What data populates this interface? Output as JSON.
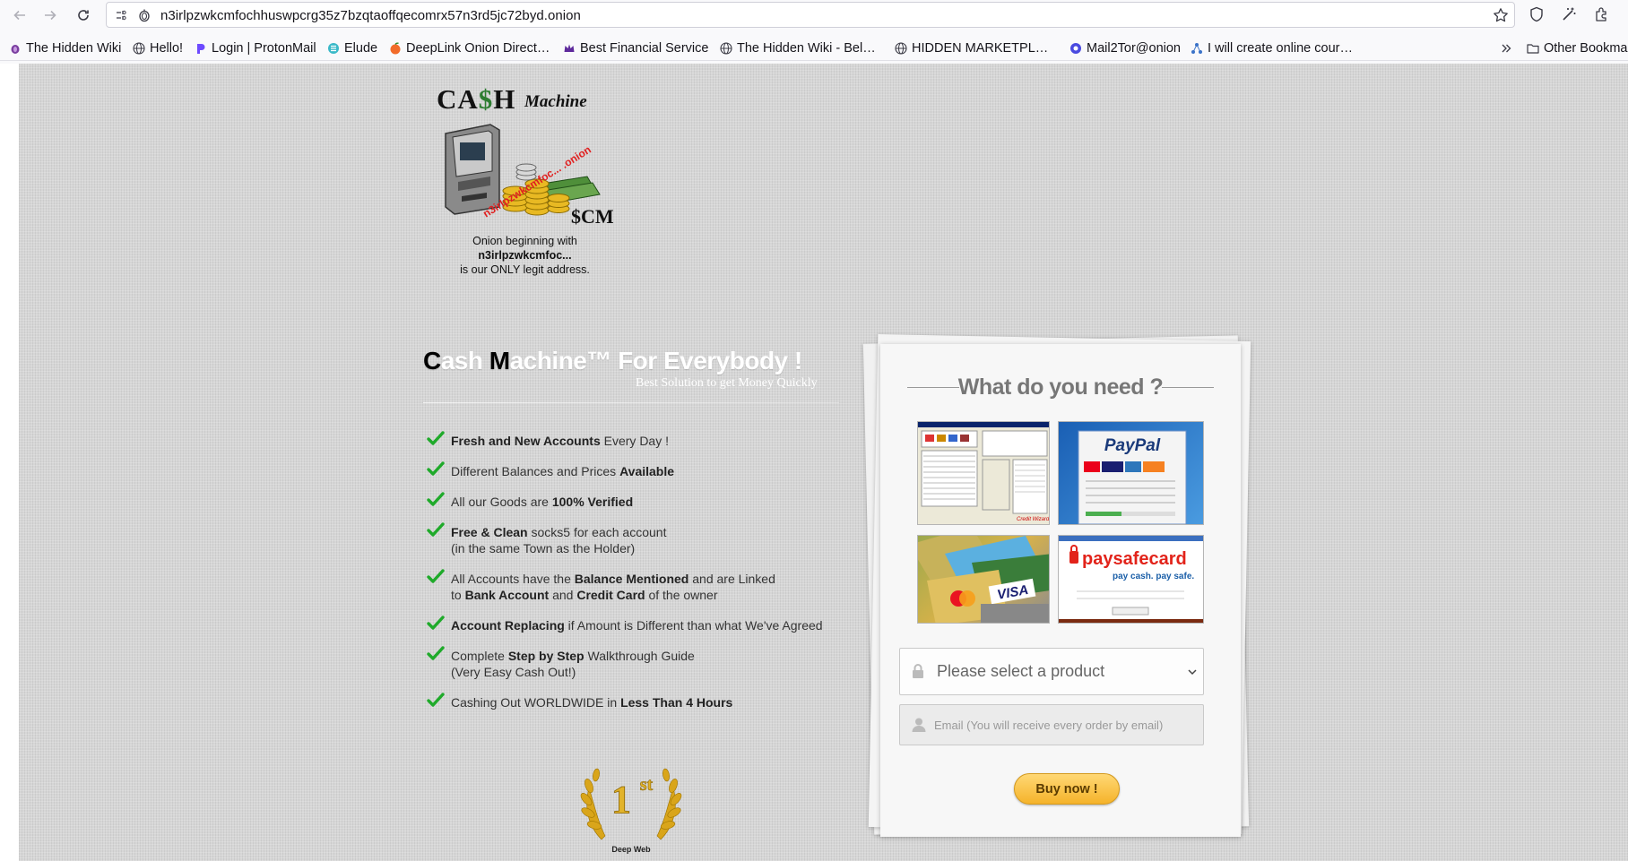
{
  "browser": {
    "url": "n3irlpzwkcmfochhuswpcrg35z7bzqtaoffqecomrx57n3rd5jc72byd.onion",
    "bookmarks": [
      {
        "label": "The Hidden Wiki",
        "icon": "onion-icon"
      },
      {
        "label": "Hello!",
        "icon": "globe-icon"
      },
      {
        "label": "Login | ProtonMail",
        "icon": "proton-icon"
      },
      {
        "label": "Elude",
        "icon": "elude-icon"
      },
      {
        "label": "DeepLink Onion Direct…",
        "icon": "peach-icon"
      },
      {
        "label": "Best Financial Service",
        "icon": "crown-icon"
      },
      {
        "label": "The Hidden Wiki - Bel…",
        "icon": "globe-icon"
      },
      {
        "label": "HIDDEN MARKETPL…",
        "icon": "globe-icon"
      },
      {
        "label": "Mail2Tor@onion",
        "icon": "mail2tor-icon"
      },
      {
        "label": "I will create online cour…",
        "icon": "network-icon"
      }
    ],
    "other_bookmarks": "Other Bookma"
  },
  "logo": {
    "title": "CA$H",
    "title_script": "Machine",
    "stamp": "n3irlpzwkcmfoc... .onion",
    "caption_line1": "Onion beginning with",
    "caption_line2": "n3irlpzwkcmfoc...",
    "caption_line3": "is our ONLY legit address."
  },
  "hero": {
    "headline_c": "C",
    "headline_ash": "ash ",
    "headline_m": "M",
    "headline_rest": "achine™ For Everybody !",
    "subhead": "Best Solution to get Money Quickly"
  },
  "features": [
    {
      "parts": [
        {
          "b": "Fresh and New Accounts"
        },
        {
          "t": " Every Day !"
        }
      ]
    },
    {
      "parts": [
        {
          "t": "Different Balances and Prices "
        },
        {
          "b": "Available"
        }
      ]
    },
    {
      "parts": [
        {
          "t": "All our Goods are "
        },
        {
          "b": "100% Verified"
        }
      ]
    },
    {
      "parts": [
        {
          "b": "Free & Clean"
        },
        {
          "t": " socks5 for each account"
        }
      ],
      "line2": "(in the same Town as the Holder)"
    },
    {
      "parts": [
        {
          "t": "All Accounts have the "
        },
        {
          "b": "Balance Mentioned"
        },
        {
          "t": " and are Linked"
        }
      ],
      "line2_parts": [
        {
          "t": "to "
        },
        {
          "b": "Bank Account"
        },
        {
          "t": " and "
        },
        {
          "b": "Credit Card"
        },
        {
          "t": " of the owner"
        }
      ]
    },
    {
      "parts": [
        {
          "b": "Account Replacing"
        },
        {
          "t": " if Amount is Different than what We've Agreed"
        }
      ]
    },
    {
      "parts": [
        {
          "t": "Complete "
        },
        {
          "b": "Step by Step"
        },
        {
          "t": " Walkthrough Guide"
        }
      ],
      "line2": "(Very Easy Cash Out!)"
    },
    {
      "parts": [
        {
          "t": "Cashing Out WORLDWIDE in "
        },
        {
          "b": "Less Than 4 Hours"
        }
      ]
    }
  ],
  "award": {
    "rank": "1st",
    "label": "Deep Web"
  },
  "order_panel": {
    "title": "What do you need ?",
    "products": [
      {
        "name": "credit-wizard-thumb",
        "label": "Credit Wizard"
      },
      {
        "name": "paypal-thumb",
        "label": "PayPal"
      },
      {
        "name": "credit-cards-thumb",
        "label": "VISA"
      },
      {
        "name": "paysafecard-thumb",
        "label": "paysafecard",
        "tagline": "pay cash. pay safe."
      }
    ],
    "select_placeholder": "Please select a product",
    "email_placeholder": "Email (You will receive every order by email)",
    "buy_label": "Buy now !"
  },
  "colors": {
    "accent_check": "#1faa2a",
    "buy_button": "#f5b32a",
    "page_bg": "#d6d6d6"
  }
}
